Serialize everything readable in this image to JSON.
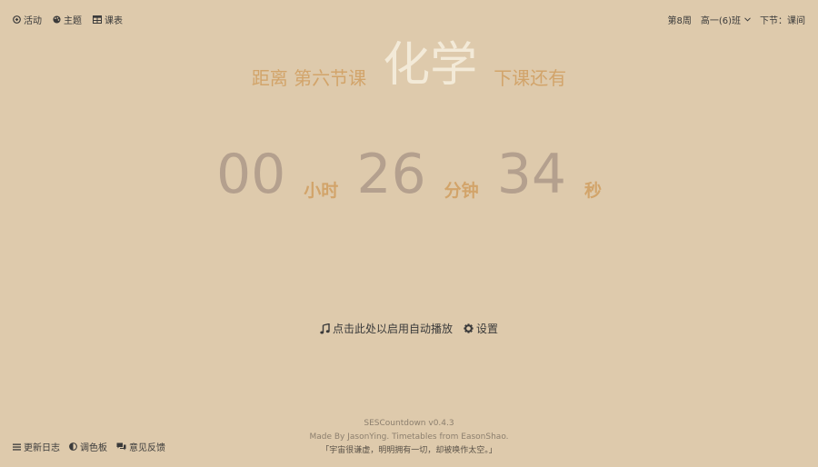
{
  "nav": {
    "activity": "活动",
    "theme": "主题",
    "timetable": "课表"
  },
  "status": {
    "week": "第8周",
    "class_name": "高一(6)班",
    "next_lesson": "下节：课间"
  },
  "headline": {
    "prefix": "距离 第六节课",
    "subject": "化学",
    "suffix": "下课还有"
  },
  "countdown": {
    "hours": "00",
    "hours_unit": "小时",
    "minutes": "26",
    "minutes_unit": "分钟",
    "seconds": "34",
    "seconds_unit": "秒"
  },
  "actions": {
    "autoplay": "点击此处以启用自动播放",
    "settings": "设置"
  },
  "bottom": {
    "changelog": "更新日志",
    "palette": "调色板",
    "feedback": "意见反馈"
  },
  "footer": {
    "version": "SESCountdown v0.4.3",
    "credits": "Made By JasonYing. Timetables from EasonShao.",
    "quote": "「宇宙很谦虚，明明拥有一切，却被唤作太空。」"
  },
  "colors": {
    "background": "#decaac",
    "accent": "#d2a46a",
    "subject": "#f3ead8",
    "digits": "#b4a08e"
  }
}
